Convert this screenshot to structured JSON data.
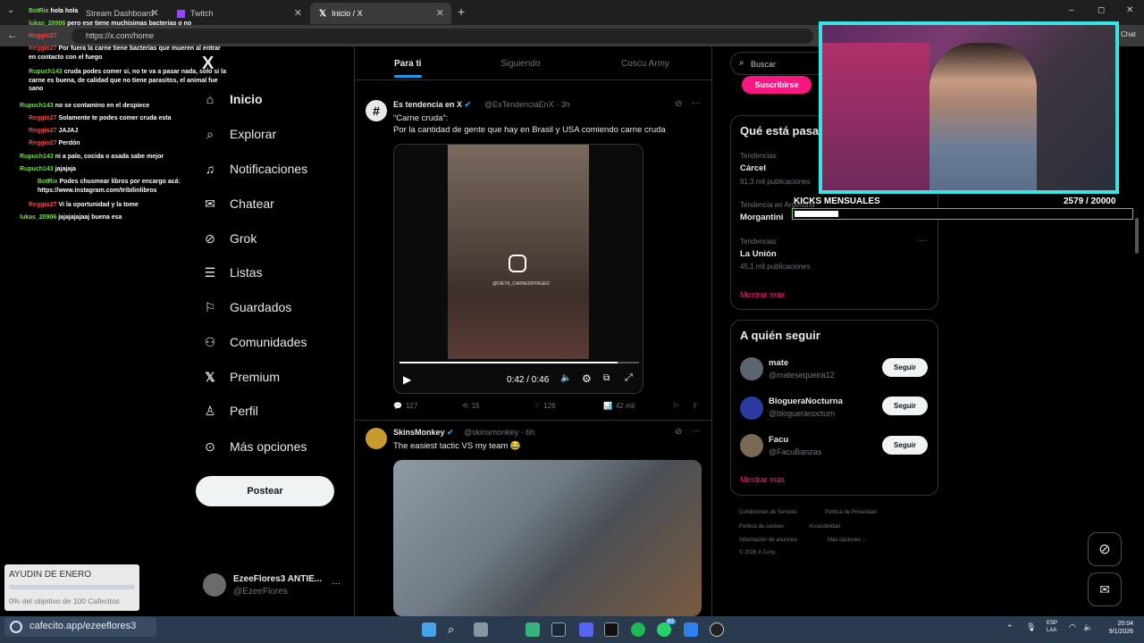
{
  "browser": {
    "tabs": [
      {
        "label": "Stream Dashboard"
      },
      {
        "label": "Twitch"
      },
      {
        "label": "Inicio / X"
      }
    ],
    "new_tab": "+",
    "url": "https://x.com/home",
    "window_controls": [
      "–",
      "◻",
      "✕"
    ],
    "chat_label": "Chat"
  },
  "chat": [
    {
      "user": "BotRix",
      "text": "hola hola",
      "color": "#7bd84a"
    },
    {
      "user": "lukas_20906",
      "text": "pero ese tiene muchisimas bacterias o no",
      "color": "#7bd84a"
    },
    {
      "user": "Reggio27",
      "text": "",
      "color": "#e64a4a"
    },
    {
      "user": "Reggio27",
      "text": "Por fuera la carne tiene bacterias que mueren al entrar en contacto con el fuego",
      "color": "#e64a4a"
    },
    {
      "user": "Rupuch143",
      "text": "cruda podes comer si, no te va a pasar nada, solo si la carne es buena, de calidad que no tiene parasitos, el animal fue sano",
      "color": "#7bd84a"
    },
    {
      "user": "Rupuch143",
      "text": "no se contamino en el despiece",
      "color": "#7bd84a"
    },
    {
      "user": "Reggio27",
      "text": "Solamente te podes comer cruda esta",
      "color": "#e64a4a"
    },
    {
      "user": "Reggio27",
      "text": "JAJAJ",
      "color": "#e64a4a"
    },
    {
      "user": "Reggio27",
      "text": "Perdón",
      "color": "#e64a4a"
    },
    {
      "user": "Rupuch143",
      "text": "ni a palo, cocida o asada sabe mejor",
      "color": "#7bd84a"
    },
    {
      "user": "Rupuch143",
      "text": "jajajaja",
      "color": "#7bd84a"
    },
    {
      "user": "BotRix",
      "text": "Podes chusmear libros por encargo acá: https://www.instagram.com/tribilinlibros",
      "color": "#7bd84a"
    },
    {
      "user": "Reggio27",
      "text": "Vi la oportunidad y la tome",
      "color": "#e64a4a"
    },
    {
      "user": "lukas_20906",
      "text": "jajajajajaaj buena esa",
      "color": "#7bd84a"
    }
  ],
  "sidebar": {
    "logo": "X",
    "items": [
      {
        "label": "Inicio",
        "icon": "home-icon"
      },
      {
        "label": "Explorar",
        "icon": "search-icon"
      },
      {
        "label": "Notificaciones",
        "icon": "bell-icon"
      },
      {
        "label": "Chatear",
        "icon": "mail-icon"
      },
      {
        "label": "Grok",
        "icon": "grok-icon"
      },
      {
        "label": "Listas",
        "icon": "list-icon"
      },
      {
        "label": "Guardados",
        "icon": "bookmark-icon"
      },
      {
        "label": "Comunidades",
        "icon": "people-icon"
      },
      {
        "label": "Premium",
        "icon": "x-icon"
      },
      {
        "label": "Perfil",
        "icon": "person-icon"
      },
      {
        "label": "Más opciones",
        "icon": "more-icon"
      }
    ],
    "post_button": "Postear",
    "account": {
      "name": "EzeeFlores3 ANTIE...",
      "handle": "@EzeeFlores",
      "more": "···"
    }
  },
  "feed": {
    "tabs": [
      "Para ti",
      "Siguiendo",
      "Coscu Army"
    ],
    "tweets": [
      {
        "author": "Es tendencia en X",
        "handle": "@EsTendenciaEnX · 3h",
        "line1": "“Carne cruda”:",
        "line2": "Por la cantidad de gente que hay en Brasil y USA comiendo carne cruda",
        "video_time": "0:42 / 0:46",
        "video_progress": 0.91,
        "watermark": "@DIETA_CARNEDRYAGED",
        "replies": "127",
        "retweets": "15",
        "likes": "126",
        "views": "42 mil"
      },
      {
        "author": "SkinsMonkey",
        "handle": "@skinsmonkey · 6h",
        "line1": "The easiest tactic VS my team 😂"
      }
    ]
  },
  "right": {
    "search_placeholder": "Buscar",
    "subscribe": "Suscribirse",
    "trending_title": "Qué está pasando",
    "trends": [
      {
        "context": "Tendencias",
        "name": "Cárcel",
        "count": "91,3 mil publicaciones"
      },
      {
        "context": "Tendencia en Argentina",
        "name": "Morgantini",
        "count": ""
      },
      {
        "context": "Tendencias",
        "name": "La Unión",
        "count": "45,1 mil publicaciones"
      }
    ],
    "show_more": "Mostrar más",
    "follow_title": "A quién seguir",
    "follow": [
      {
        "name": "mate",
        "handle": "@matesequeira12"
      },
      {
        "name": "BlogueraNocturna",
        "handle": "@blogueranocturn"
      },
      {
        "name": "Facu",
        "handle": "@FacuBanzas"
      }
    ],
    "follow_button": "Seguir",
    "show_more_2": "Mostrar más",
    "footer": [
      "Condiciones de Servicio",
      "Política de Privacidad",
      "Política de cookies",
      "Accesibilidad",
      "Información de anuncios",
      "Más opciones ···",
      "© 2026 X Corp."
    ]
  },
  "overlay": {
    "kicks_label": "KICKS MENSUALES",
    "kicks_value": "2579",
    "kicks_goal": "/ 20000",
    "kicks_progress": 0.129,
    "donation_title": "AYUDIN DE ENERO",
    "donation_text": "0% del objetivo de 100 Cafecitos",
    "donation_progress": 0,
    "cafecito_url": "cafecito.app/ezeeflores3"
  },
  "taskbar": {
    "lang": "ESP",
    "lang2": "LAA",
    "time": "20:04",
    "date": "9/1/2026",
    "badge": "63"
  },
  "colors": {
    "accent": "#1d9bf0",
    "subscribe": "#f91880",
    "cam_border": "#38e5e5"
  }
}
